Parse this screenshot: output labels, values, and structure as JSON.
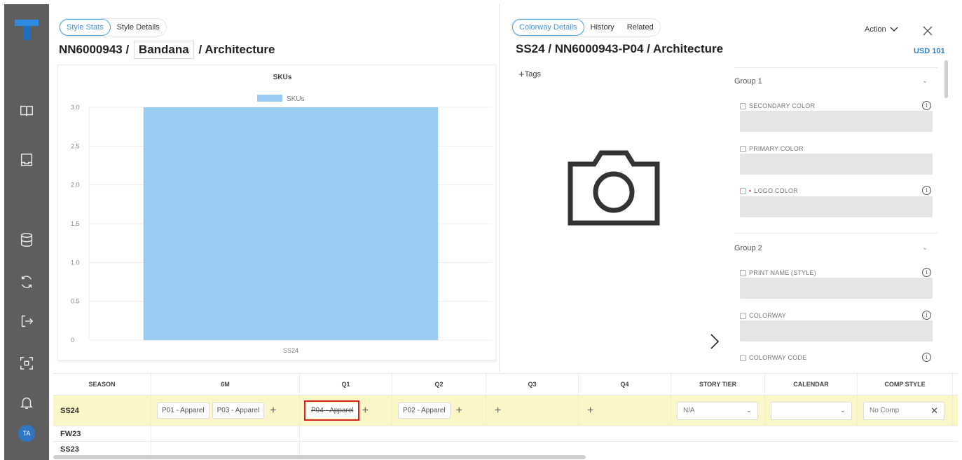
{
  "sidebar": {
    "avatar_initials": "TA",
    "icons": [
      "book-icon",
      "inbox-icon",
      "database-icon",
      "refresh-icon",
      "export-icon",
      "scan-icon",
      "bell-icon"
    ]
  },
  "left": {
    "tabs": [
      "Style Stats",
      "Style Details"
    ],
    "title_prefix": "NN6000943 /",
    "title_boxed": "Bandana",
    "title_suffix": "/ Architecture"
  },
  "chart_data": {
    "type": "bar",
    "title": "SKUs",
    "legend": "SKUs",
    "categories": [
      "SS24"
    ],
    "series": [
      {
        "name": "SKUs",
        "values": [
          3
        ]
      }
    ],
    "ylim": [
      0,
      3
    ],
    "yticks": [
      "3.0",
      "2.5",
      "2.0",
      "1.5",
      "1.0",
      "0.5",
      "0"
    ],
    "bar_color": "#99ccf0",
    "grid": true,
    "legend_position": "top"
  },
  "right": {
    "tabs": [
      "Colorway Details",
      "History",
      "Related"
    ],
    "title": "SS24 / NN6000943-P04 / Architecture",
    "action_label": "Action",
    "currency": "USD 101",
    "tags_label": "Tags",
    "groups": [
      {
        "name": "Group 1",
        "fields": [
          {
            "label": "SECONDARY COLOR",
            "info": true,
            "required": false
          },
          {
            "label": "PRIMARY COLOR",
            "info": false,
            "required": false
          },
          {
            "label": "LOGO COLOR",
            "info": true,
            "required": true
          }
        ]
      },
      {
        "name": "Group 2",
        "fields": [
          {
            "label": "PRINT NAME (STYLE)",
            "info": true,
            "required": false
          },
          {
            "label": "COLORWAY",
            "info": true,
            "required": false
          },
          {
            "label": "COLORWAY CODE",
            "info": true,
            "required": false
          }
        ]
      }
    ]
  },
  "grid": {
    "headers": [
      "SEASON",
      "6M",
      "Q1",
      "Q2",
      "Q3",
      "Q4",
      "STORY TIER",
      "CALENDAR",
      "COMP STYLE"
    ],
    "rows": [
      {
        "season": "SS24",
        "m6": [
          "P01 - Apparel",
          "P03 - Apparel"
        ],
        "q1": [
          "P04 - Apparel"
        ],
        "q2": [
          "P02 - Apparel"
        ],
        "story_tier": "N/A",
        "calendar": "",
        "comp_style": "No Comp"
      },
      {
        "season": "FW23"
      },
      {
        "season": "SS23"
      }
    ]
  },
  "colors": {
    "accent": "#4a8fd0",
    "highlight_row": "#fbf6c8",
    "sidebar": "#5e5e5e",
    "selection_outline": "#d32020"
  }
}
